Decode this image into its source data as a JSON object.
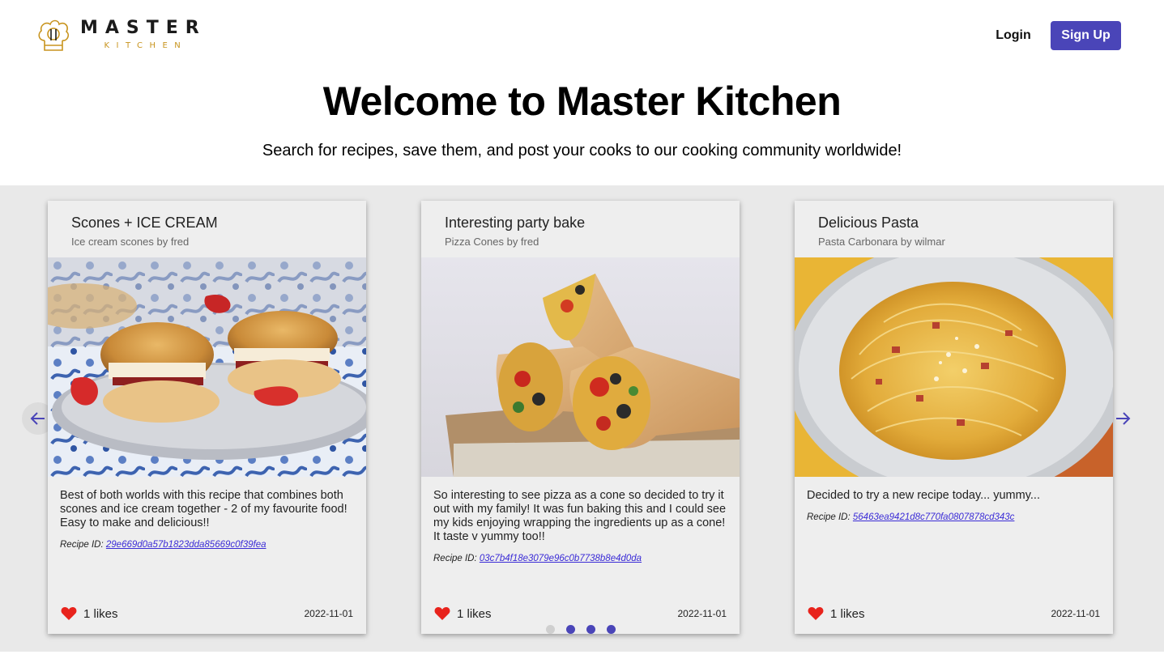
{
  "header": {
    "logo_main": "MASTER",
    "logo_sub": "KITCHEN",
    "login_label": "Login",
    "signup_label": "Sign Up"
  },
  "hero": {
    "title": "Welcome to Master Kitchen",
    "subtitle": "Search for recipes, save them, and post your cooks to our cooking community worldwide!"
  },
  "colors": {
    "accent": "#4a45b8",
    "heart": "#e8231c",
    "link": "#3a2bd6",
    "carousel_bg": "#e9e9e9"
  },
  "carousel": {
    "prev_icon": "arrow-left-icon",
    "next_icon": "arrow-right-icon",
    "cards": [
      {
        "title": "Scones + ICE CREAM",
        "subtitle": "Ice cream scones by fred",
        "image": "scones-photo",
        "description": "Best of both worlds with this recipe that combines both scones and ice cream together - 2 of my favourite food! Easy to make and delicious!!",
        "recipe_label": "Recipe ID:",
        "recipe_id": "29e669d0a57b1823dda85669c0f39fea",
        "likes": "1 likes",
        "date": "2022-11-01"
      },
      {
        "title": "Interesting party bake",
        "subtitle": "Pizza Cones by fred",
        "image": "pizza-cones-photo",
        "description": "So interesting to see pizza as a cone so decided to try it out with my family! It was fun baking this and I could see my kids enjoying wrapping the ingredients up as a cone! It taste v yummy too!!",
        "recipe_label": "Recipe ID:",
        "recipe_id": "03c7b4f18e3079e96c0b7738b8e4d0da",
        "likes": "1 likes",
        "date": "2022-11-01"
      },
      {
        "title": "Delicious Pasta",
        "subtitle": "Pasta Carbonara by wilmar",
        "image": "pasta-carbonara-photo",
        "description": "Decided to try a new recipe today... yummy...",
        "recipe_label": "Recipe ID:",
        "recipe_id": "56463ea9421d8c770fa0807878cd343c",
        "likes": "1 likes",
        "date": "2022-11-01"
      }
    ],
    "pagination": {
      "count": 4,
      "active_index": 0
    }
  }
}
